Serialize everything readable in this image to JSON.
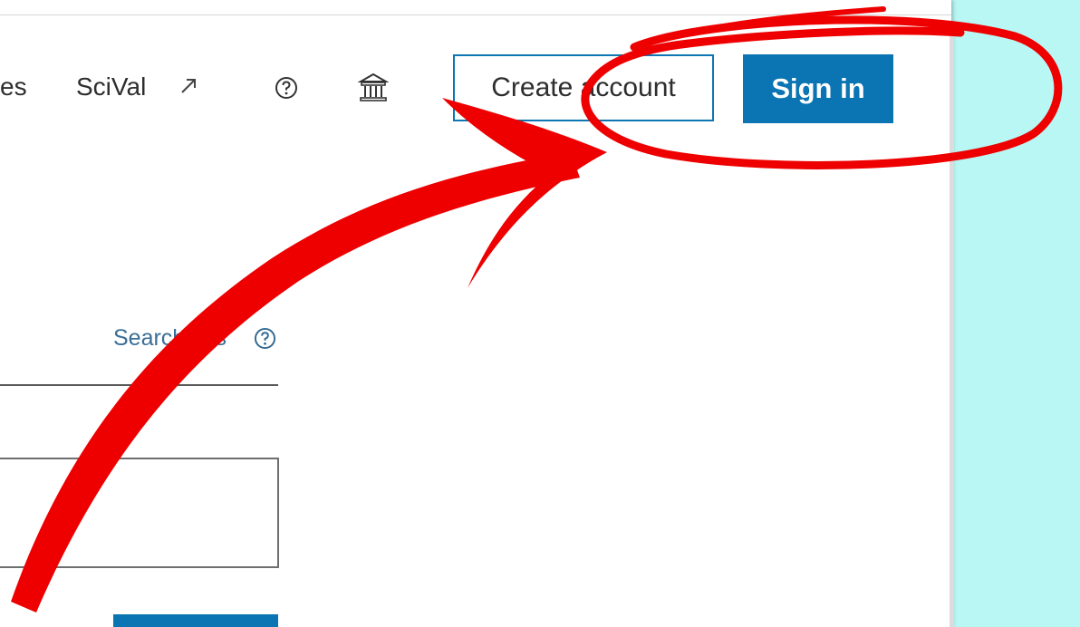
{
  "nav": {
    "partial_item_label": "es",
    "scival_label": "SciVal",
    "icons": {
      "external_link": "external-link-icon",
      "help": "question-circle-icon",
      "institution": "institution-building-icon"
    }
  },
  "auth": {
    "create_account_label": "Create account",
    "sign_in_label": "Sign in"
  },
  "search": {
    "tips_label": "Search tips",
    "tips_icon": "question-circle-icon",
    "input_value": ""
  },
  "annotation": {
    "type": "red arrow and ellipse highlighting sign-in area"
  },
  "colors": {
    "brand_blue": "#0b74b3",
    "link_blue": "#3a6e96",
    "annotation_red": "#ee0000",
    "side_background": "#b9f7f5"
  }
}
